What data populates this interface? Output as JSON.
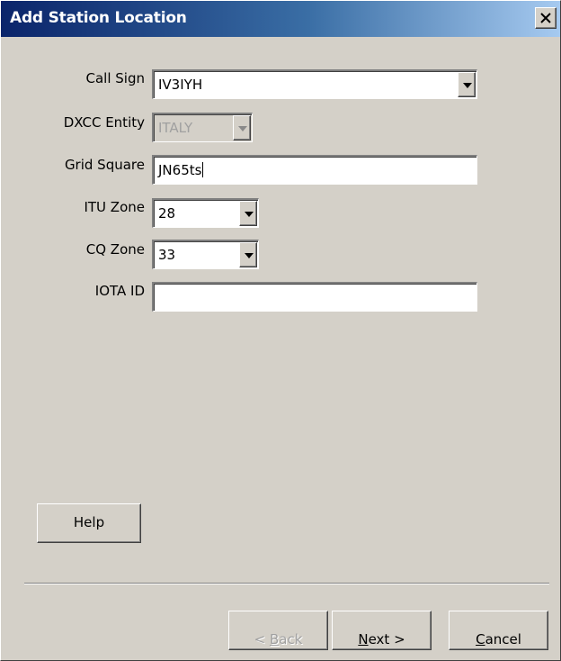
{
  "window": {
    "title": "Add Station Location",
    "close_glyph": "X"
  },
  "fields": {
    "call_sign": {
      "label": "Call Sign",
      "value": "IV3IYH"
    },
    "dxcc_entity": {
      "label": "DXCC Entity",
      "value": "ITALY"
    },
    "grid_square": {
      "label": "Grid Square",
      "value": "JN65ts"
    },
    "itu_zone": {
      "label": "ITU Zone",
      "value": "28"
    },
    "cq_zone": {
      "label": "CQ Zone",
      "value": "33"
    },
    "iota_id": {
      "label": "IOTA ID",
      "value": ""
    }
  },
  "buttons": {
    "help": "Help",
    "back": {
      "prefix": "< ",
      "mnemonic": "B",
      "rest": "ack"
    },
    "next": {
      "mnemonic": "N",
      "rest": "ext >"
    },
    "cancel": {
      "mnemonic": "C",
      "rest": "ancel"
    }
  },
  "icons": {
    "close": "close-icon",
    "dropdown": "chevron-down-icon"
  },
  "colors": {
    "titlebar_start": "#0a246a",
    "titlebar_end": "#a6caf0",
    "dialog_face": "#d4d0c8",
    "disabled_text": "#a0a0a0"
  }
}
